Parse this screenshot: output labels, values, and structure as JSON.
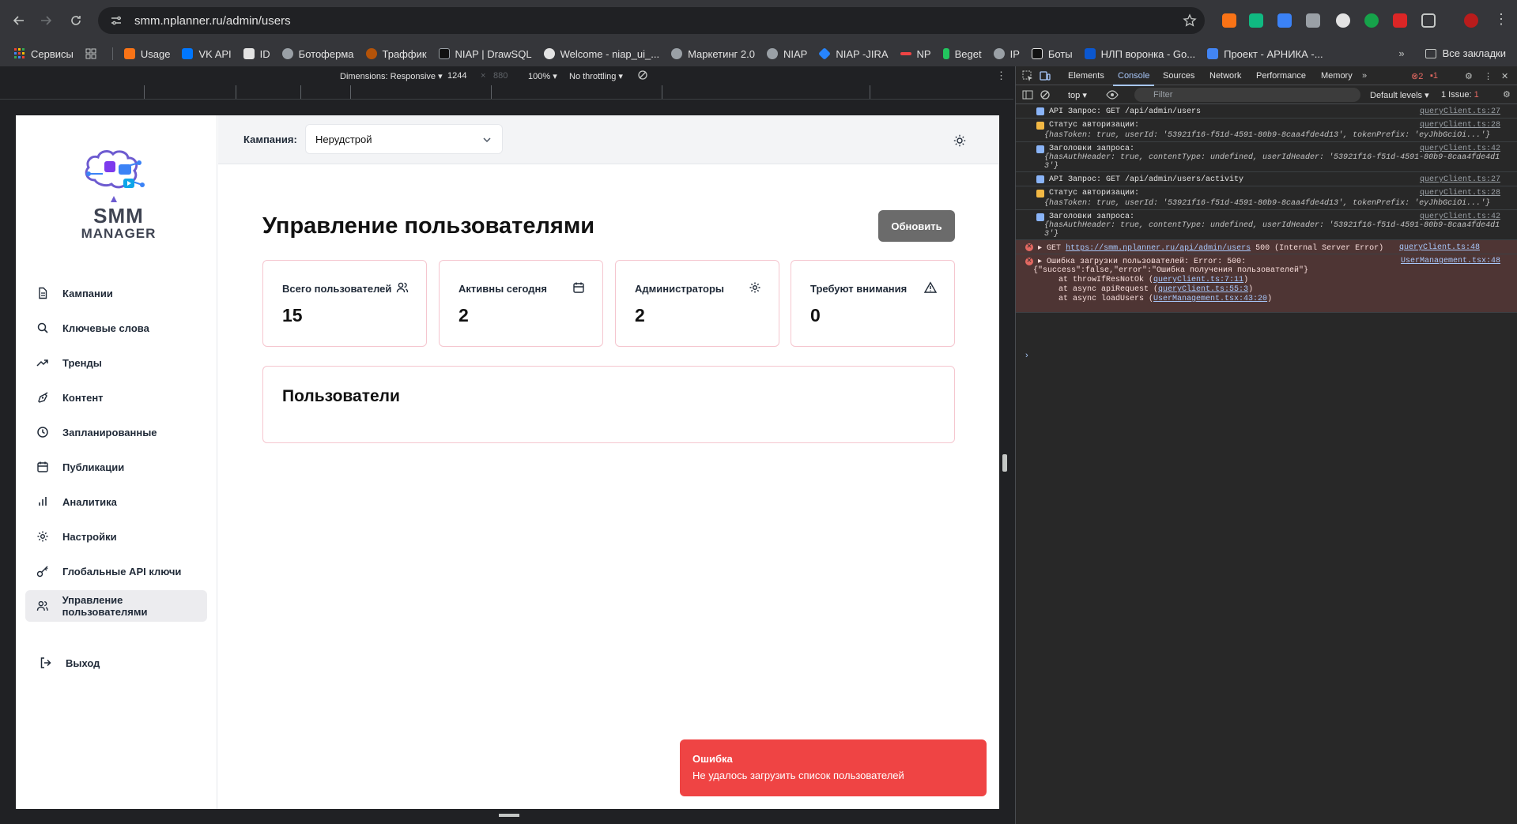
{
  "browser": {
    "url": "smm.nplanner.ru/admin/users",
    "bookmarks": [
      {
        "label": "Сервисы",
        "color": "#f4b400"
      },
      {
        "label": "Usage",
        "color": "#f97316"
      },
      {
        "label": "VK API",
        "color": "#0077ff"
      },
      {
        "label": "ID",
        "color": "#e3e3e3"
      },
      {
        "label": "Ботоферма",
        "color": "#9aa0a6"
      },
      {
        "label": "Траффик",
        "color": "#b45309"
      },
      {
        "label": "NIAP | DrawSQL",
        "color": "#111111"
      },
      {
        "label": "Welcome - niap_ui_...",
        "color": "#e3e3e3"
      },
      {
        "label": "Маркетинг 2.0",
        "color": "#9aa0a6"
      },
      {
        "label": "NIAP",
        "color": "#9aa0a6"
      },
      {
        "label": "NIAP -JIRA",
        "color": "#2684ff"
      },
      {
        "label": "NP",
        "color": "#ef4444"
      },
      {
        "label": "Beget",
        "color": "#22c55e"
      },
      {
        "label": "IP",
        "color": "#9aa0a6"
      },
      {
        "label": "Боты",
        "color": "#111111"
      },
      {
        "label": "НЛП воронка - Go...",
        "color": "#0b57d0"
      },
      {
        "label": "Проект - АРНИКА -...",
        "color": "#4285f4"
      }
    ],
    "all_bookmarks": "Все закладки"
  },
  "device_toolbar": {
    "dimensions_label": "Dimensions: Responsive",
    "width": "1244",
    "height": "880",
    "zoom": "100%",
    "throttling": "No throttling"
  },
  "app": {
    "logo_line1": "SMM",
    "logo_line2": "MANAGER",
    "nav": [
      {
        "label": "Кампании",
        "icon": "document-icon"
      },
      {
        "label": "Ключевые слова",
        "icon": "search-icon"
      },
      {
        "label": "Тренды",
        "icon": "trending-icon"
      },
      {
        "label": "Контент",
        "icon": "pen-icon"
      },
      {
        "label": "Запланированные",
        "icon": "clock-icon"
      },
      {
        "label": "Публикации",
        "icon": "calendar-icon"
      },
      {
        "label": "Аналитика",
        "icon": "bar-chart-icon"
      },
      {
        "label": "Настройки",
        "icon": "gear-icon"
      },
      {
        "label": "Глобальные API ключи",
        "icon": "key-icon"
      },
      {
        "label": "Управление пользователями",
        "icon": "users-icon"
      }
    ],
    "logout": "Выход",
    "campaign_label": "Кампания:",
    "campaign_value": "Нерудстрой",
    "page_title": "Управление пользователями",
    "refresh_button": "Обновить",
    "stats": [
      {
        "label": "Всего пользователей",
        "value": "15",
        "icon": "users-icon"
      },
      {
        "label": "Активны сегодня",
        "value": "2",
        "icon": "calendar-icon"
      },
      {
        "label": "Администраторы",
        "value": "2",
        "icon": "gear-icon"
      },
      {
        "label": "Требуют внимания",
        "value": "0",
        "icon": "warning-icon"
      }
    ],
    "users_section_title": "Пользователи",
    "toast": {
      "title": "Ошибка",
      "message": "Не удалось загрузить список пользователей"
    }
  },
  "devtools": {
    "tabs": [
      "Elements",
      "Console",
      "Sources",
      "Network",
      "Performance",
      "Memory"
    ],
    "active_tab": "Console",
    "error_count": "2",
    "warn_count": "1",
    "context": "top",
    "filter_placeholder": "Filter",
    "levels": "Default levels",
    "issues": "1 Issue:",
    "issues_count": "1",
    "logs": {
      "l1_msg": "API Запрос: GET /api/admin/users",
      "l1_src": "queryClient.ts:27",
      "l2_msg": "Статус авторизации:",
      "l2_src": "queryClient.ts:28",
      "l2_obj": "{hasToken: true, userId: '53921f16-f51d-4591-80b9-8caa4fde4d13', tokenPrefix: 'eyJhbGciOi...'}",
      "l3_msg": "Заголовки запроса:",
      "l3_src": "queryClient.ts:42",
      "l3_obj1": "{hasAuthHeader: true, contentType: undefined, userIdHeader: '53921f16-f51d-4591-80b9-8caa4fde4d1",
      "l3_obj2": "3'}",
      "l4_msg": "API Запрос: GET /api/admin/users/activity",
      "l4_src": "queryClient.ts:27",
      "l5_msg": "Статус авторизации:",
      "l5_src": "queryClient.ts:28",
      "l5_obj": "{hasToken: true, userId: '53921f16-f51d-4591-80b9-8caa4fde4d13', tokenPrefix: 'eyJhbGciOi...'}",
      "l6_msg": "Заголовки запроса:",
      "l6_src": "queryClient.ts:42",
      "l6_obj1": "{hasAuthHeader: true, contentType: undefined, userIdHeader: '53921f16-f51d-4591-80b9-8caa4fde4d1",
      "l6_obj2": "3'}",
      "e1_prefix": "GET",
      "e1_url": "https://smm.nplanner.ru/api/admin/users",
      "e1_status": "500 (Internal Server Error)",
      "e1_src": "queryClient.ts:48",
      "e2_line1": "Ошибка загрузки пользователей: Error: 500:",
      "e2_src": "UserManagement.tsx:48",
      "e2_line2": "{\"success\":false,\"error\":\"Ошибка получения пользователей\"}",
      "e2_line3_a": "at throwIfResNotOk (",
      "e2_line3_link": "queryClient.ts:7:11",
      "e2_line4_a": "at async apiRequest (",
      "e2_line4_link": "queryClient.ts:55:3",
      "e2_line5_a": "at async loadUsers (",
      "e2_line5_link": "UserManagement.tsx:43:20",
      "close_paren": ")"
    }
  }
}
